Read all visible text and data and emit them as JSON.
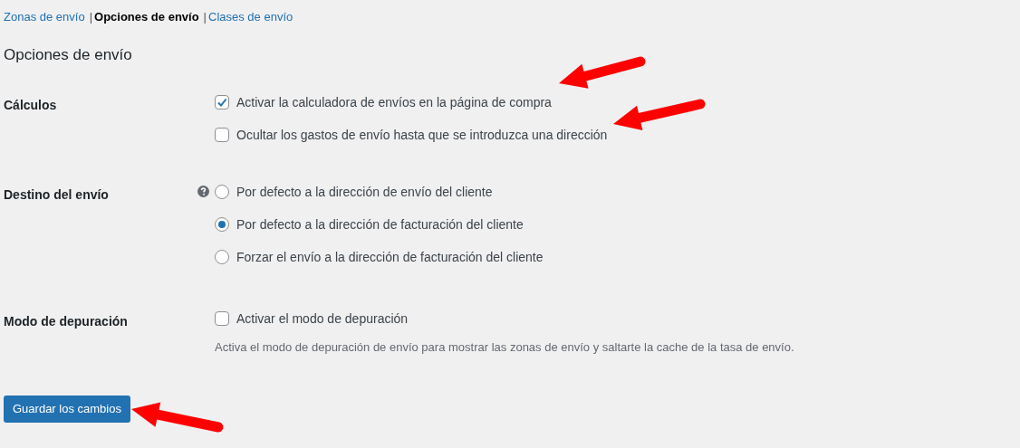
{
  "subnav": [
    {
      "label": "Zonas de envío",
      "selected": false
    },
    {
      "label": "Opciones de envío",
      "selected": true
    },
    {
      "label": "Clases de envío",
      "selected": false
    }
  ],
  "subnav_separator": "|",
  "heading": "Opciones de envío",
  "sections": [
    {
      "label": "Cálculos",
      "help": false,
      "options": [
        {
          "kind": "checkbox",
          "label": "Activar la calculadora de envíos en la página de compra",
          "checked": true
        },
        {
          "kind": "checkbox",
          "label": "Ocultar los gastos de envío hasta que se introduzca una dirección",
          "checked": false
        }
      ]
    },
    {
      "label": "Destino del envío",
      "help": true,
      "options": [
        {
          "kind": "radio",
          "label": "Por defecto a la dirección de envío del cliente",
          "selected": false
        },
        {
          "kind": "radio",
          "label": "Por defecto a la dirección de facturación del cliente",
          "selected": true
        },
        {
          "kind": "radio",
          "label": "Forzar el envío a la dirección de facturación del cliente",
          "selected": false
        }
      ]
    },
    {
      "label": "Modo de depuración",
      "help": false,
      "options": [
        {
          "kind": "checkbox",
          "label": "Activar el modo de depuración",
          "checked": false
        }
      ],
      "description": "Activa el modo de depuración de envío para mostrar las zonas de envío y saltarte la cache de la tasa de envío."
    }
  ],
  "save_button": "Guardar los cambios"
}
